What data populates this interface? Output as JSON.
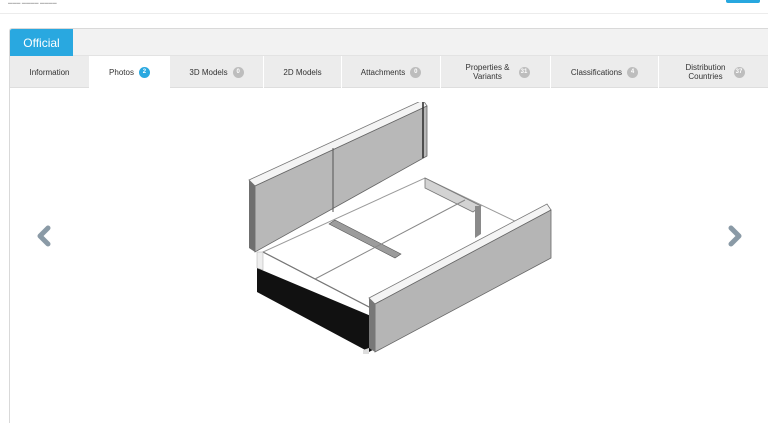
{
  "header": {
    "official_tab": "Official"
  },
  "tabs": [
    {
      "label": "Information",
      "badge": null,
      "active": false
    },
    {
      "label": "Photos",
      "badge": "2",
      "active": true
    },
    {
      "label": "3D Models",
      "badge": "0",
      "active": false
    },
    {
      "label": "2D Models",
      "badge": null,
      "active": false
    },
    {
      "label": "Attachments",
      "badge": "0",
      "active": false
    },
    {
      "label": "Properties & Variants",
      "badge": "31",
      "active": false
    },
    {
      "label": "Classifications",
      "badge": "4",
      "active": false
    },
    {
      "label": "Distribution Countries",
      "badge": "37",
      "active": false
    }
  ],
  "viewer": {
    "prev_icon": "chevron-left-icon",
    "next_icon": "chevron-right-icon",
    "image_subject": "product-3d-model"
  },
  "colors": {
    "accent": "#29a8e0",
    "badge_inactive": "#bdbdbd",
    "tab_bar": "#ececec",
    "arrow": "#8a9aa6"
  }
}
